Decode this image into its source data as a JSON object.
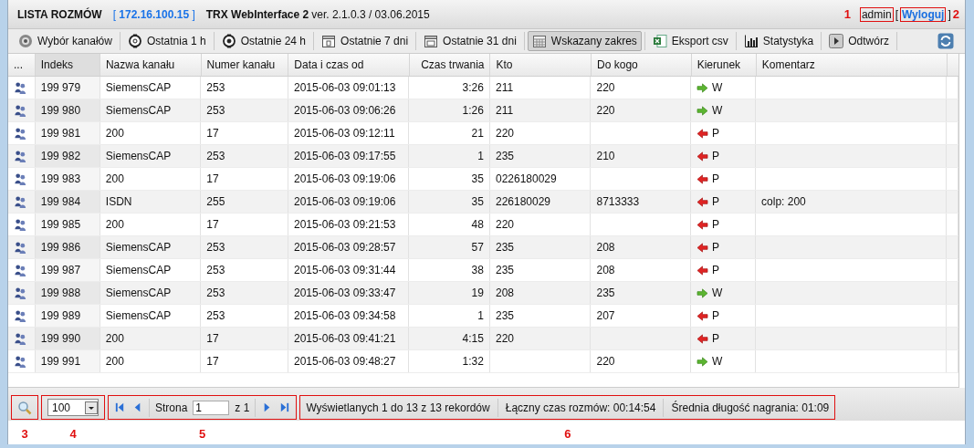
{
  "header": {
    "title": "LISTA ROZMÓW",
    "ip_open": "[",
    "ip": "172.16.100.15",
    "ip_close": "]",
    "app_name": "TRX WebInterface 2",
    "version": "ver. 2.1.0.3 / 03.06.2015",
    "user_callout": "1",
    "user": "admin",
    "logout_open": "[",
    "logout": "Wyloguj",
    "logout_close": "]",
    "logout_callout": "2"
  },
  "toolbar": [
    {
      "kind": "speaker",
      "label": "Wybór kanałów",
      "selected": false
    },
    {
      "kind": "clock1",
      "label": "Ostatnia 1 h",
      "selected": false
    },
    {
      "kind": "clock24",
      "label": "Ostatnie 24 h",
      "selected": false
    },
    {
      "kind": "cal7",
      "label": "Ostatnie 7 dni",
      "selected": false
    },
    {
      "kind": "cal31",
      "label": "Ostatnie 31 dni",
      "selected": false
    },
    {
      "kind": "calgrid",
      "label": "Wskazany zakres",
      "selected": true
    },
    {
      "kind": "excel",
      "label": "Eksport csv",
      "selected": false
    },
    {
      "kind": "chart",
      "label": "Statystyka",
      "selected": false
    },
    {
      "kind": "play",
      "label": "Odtwórz",
      "selected": false
    }
  ],
  "table": {
    "columns": [
      "...",
      "Indeks",
      "Nazwa kanału",
      "Numer kanału",
      "Data i czas od",
      "Czas trwania",
      "Kto",
      "Do kogo",
      "Kierunek",
      "Komentarz"
    ],
    "rows": [
      {
        "index": "199 979",
        "channel_name": "SiemensCAP",
        "channel_number": "253",
        "start": "2015-06-03 09:01:13",
        "duration": "3:26",
        "from": "211",
        "to": "220",
        "incoming": false,
        "direction_label": "W"
      },
      {
        "index": "199 980",
        "channel_name": "SiemensCAP",
        "channel_number": "253",
        "start": "2015-06-03 09:06:26",
        "duration": "1:26",
        "from": "211",
        "to": "220",
        "incoming": false,
        "direction_label": "W"
      },
      {
        "index": "199 981",
        "channel_name": "200",
        "channel_number": "17",
        "start": "2015-06-03 09:12:11",
        "duration": "21",
        "from": "220",
        "incoming": true,
        "direction_label": "P"
      },
      {
        "index": "199 982",
        "channel_name": "SiemensCAP",
        "channel_number": "253",
        "start": "2015-06-03 09:17:55",
        "duration": "1",
        "from": "235",
        "to": "210",
        "incoming": true,
        "direction_label": "P"
      },
      {
        "index": "199 983",
        "channel_name": "200",
        "channel_number": "17",
        "start": "2015-06-03 09:19:06",
        "duration": "35",
        "from": "0226180029",
        "incoming": true,
        "direction_label": "P"
      },
      {
        "index": "199 984",
        "channel_name": "ISDN",
        "channel_number": "255",
        "start": "2015-06-03 09:19:06",
        "duration": "35",
        "from": "226180029",
        "to": "8713333",
        "incoming": true,
        "direction_label": "P",
        "comment": "colp: 200"
      },
      {
        "index": "199 985",
        "channel_name": "200",
        "channel_number": "17",
        "start": "2015-06-03 09:21:53",
        "duration": "48",
        "from": "220",
        "incoming": true,
        "direction_label": "P"
      },
      {
        "index": "199 986",
        "channel_name": "SiemensCAP",
        "channel_number": "253",
        "start": "2015-06-03 09:28:57",
        "duration": "57",
        "from": "235",
        "to": "208",
        "incoming": true,
        "direction_label": "P"
      },
      {
        "index": "199 987",
        "channel_name": "SiemensCAP",
        "channel_number": "253",
        "start": "2015-06-03 09:31:44",
        "duration": "38",
        "from": "235",
        "to": "208",
        "incoming": true,
        "direction_label": "P"
      },
      {
        "index": "199 988",
        "channel_name": "SiemensCAP",
        "channel_number": "253",
        "start": "2015-06-03 09:33:47",
        "duration": "19",
        "from": "208",
        "to": "235",
        "incoming": false,
        "direction_label": "W"
      },
      {
        "index": "199 989",
        "channel_name": "SiemensCAP",
        "channel_number": "253",
        "start": "2015-06-03 09:34:58",
        "duration": "1",
        "from": "235",
        "to": "207",
        "incoming": true,
        "direction_label": "P"
      },
      {
        "index": "199 990",
        "channel_name": "200",
        "channel_number": "17",
        "start": "2015-06-03 09:41:21",
        "duration": "4:15",
        "from": "220",
        "incoming": true,
        "direction_label": "P"
      },
      {
        "index": "199 991",
        "channel_name": "200",
        "channel_number": "17",
        "start": "2015-06-03 09:48:27",
        "duration": "1:32",
        "to": "220",
        "incoming": false,
        "direction_label": "W"
      }
    ]
  },
  "footer": {
    "search_callout": "3",
    "page_size": "100",
    "page_size_callout": "4",
    "page_label": "Strona",
    "page": "1",
    "page_of": "z 1",
    "pager_callout": "5",
    "status": [
      "Wyświetlanych 1 do 13 z 13 rekordów",
      "Łączny czas rozmów: 00:14:54",
      "Średnia długość nagrania: 01:09"
    ],
    "status_callout": "6"
  }
}
